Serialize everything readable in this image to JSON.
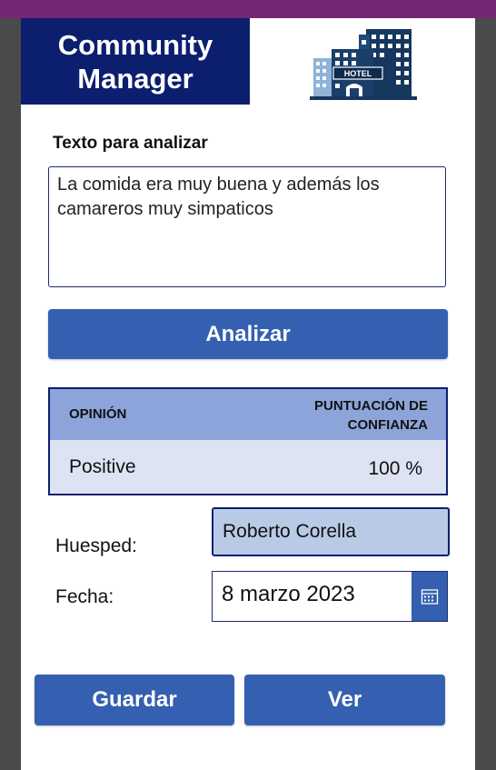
{
  "header": {
    "title_line1": "Community",
    "title_line2": "Manager",
    "logo_text": "HOTEL",
    "logo_icon": "hotel-building-icon"
  },
  "analysis": {
    "label": "Texto para analizar",
    "input_value": "La comida era muy buena y además los camareros muy simpaticos",
    "button_label": "Analizar"
  },
  "results": {
    "col_opinion": "OPINIÓN",
    "col_confidence_line1": "PUNTUACIÓN DE",
    "col_confidence_line2": "CONFIANZA",
    "opinion": "Positive",
    "confidence": "100 %"
  },
  "form": {
    "guest_label": "Huesped:",
    "guest_value": "Roberto Corella",
    "date_label": "Fecha:",
    "date_value": "8 marzo 2023",
    "calendar_icon": "calendar-icon"
  },
  "actions": {
    "save_label": "Guardar",
    "view_label": "Ver"
  },
  "colors": {
    "brand_navy": "#0c1f6e",
    "button_blue": "#3560b1",
    "table_header": "#8ca4d9",
    "table_row": "#dde3f2",
    "guest_field": "#b9cae6",
    "top_bar": "#742774"
  }
}
